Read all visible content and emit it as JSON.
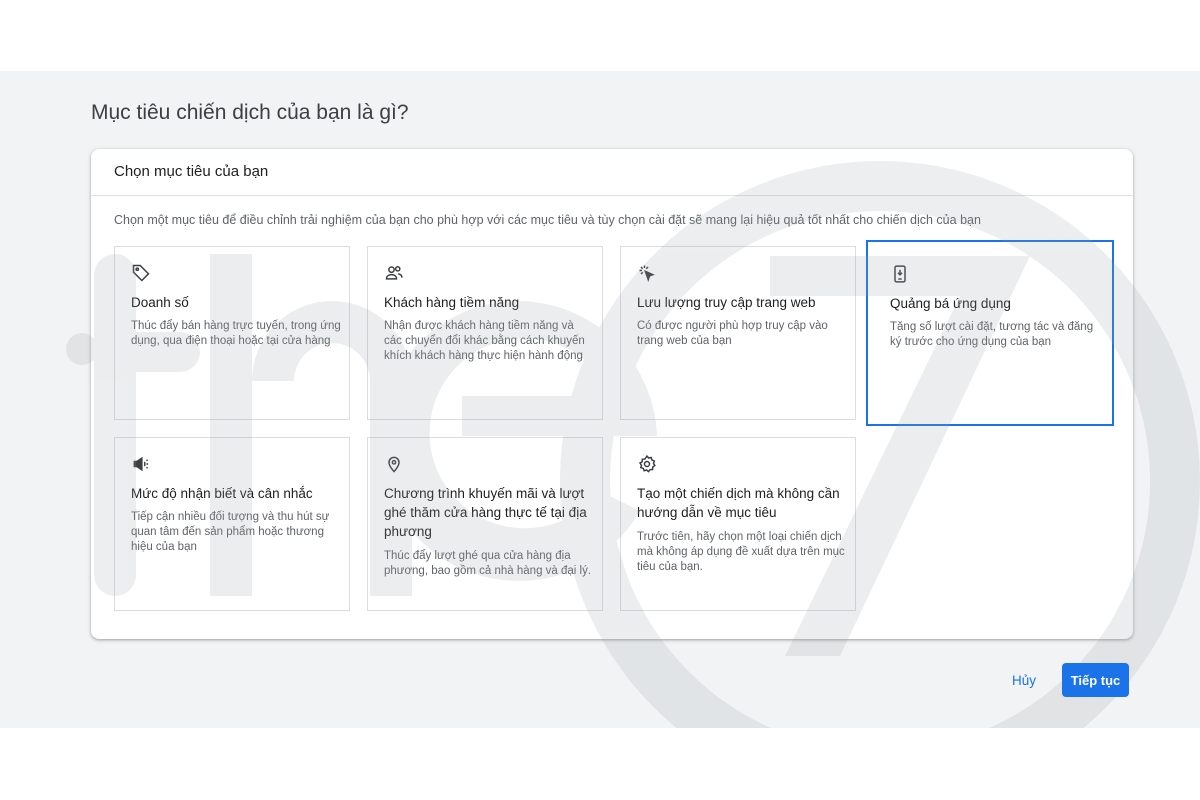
{
  "page": {
    "title": "Mục tiêu chiến dịch của bạn là gì?"
  },
  "card": {
    "header": "Chọn mục tiêu của bạn",
    "description": "Chọn một mục tiêu để điều chỉnh trải nghiệm của bạn cho phù hợp với các mục tiêu và tùy chọn cài đặt sẽ mang lại hiệu quả tốt nhất cho chiến dịch của bạn"
  },
  "goals": [
    {
      "icon": "tag-icon",
      "title": "Doanh số",
      "description": "Thúc đẩy bán hàng trực tuyến, trong ứng dụng, qua điện thoại hoặc tại cửa hàng",
      "selected": false
    },
    {
      "icon": "people-icon",
      "title": "Khách hàng tiềm năng",
      "description": "Nhận được khách hàng tiềm năng và các chuyển đổi khác bằng cách khuyến khích khách hàng thực hiện hành động",
      "selected": false
    },
    {
      "icon": "cursor-click-icon",
      "title": "Lưu lượng truy cập trang web",
      "description": "Có được người phù hợp truy cập vào trang web của bạn",
      "selected": false
    },
    {
      "icon": "phone-download-icon",
      "title": "Quảng bá ứng dụng",
      "description": "Tăng số lượt cài đặt, tương tác và đăng ký trước cho ứng dụng của bạn",
      "selected": true
    },
    {
      "icon": "megaphone-icon",
      "title": "Mức độ nhận biết và cân nhắc",
      "description": "Tiếp cận nhiều đối tượng và thu hút sự quan tâm đến sản phẩm hoặc thương hiệu của bạn",
      "selected": false
    },
    {
      "icon": "location-pin-icon",
      "title": "Chương trình khuyến mãi và lượt ghé thăm cửa hàng thực tế tại địa phương",
      "description": "Thúc đẩy lượt ghé qua cửa hàng địa phương, bao gồm cả nhà hàng và đại lý.",
      "selected": false
    },
    {
      "icon": "gear-icon",
      "title": "Tạo một chiến dịch mà không cần hướng dẫn về mục tiêu",
      "description": "Trước tiên, hãy chọn một loại chiến dịch mà không áp dụng đề xuất dựa trên mục tiêu của bạn.",
      "selected": false
    }
  ],
  "actions": {
    "cancel": "Hủy",
    "continue": "Tiếp tục"
  },
  "colors": {
    "accent": "#1a73e8",
    "background_band": "#f1f3f4"
  }
}
